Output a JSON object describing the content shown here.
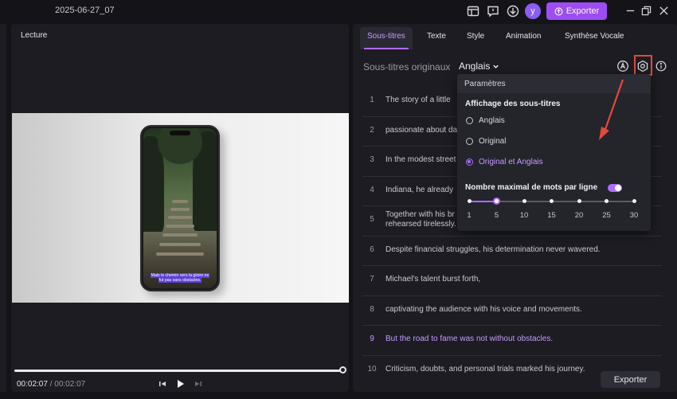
{
  "app": {
    "project_name": "2025-06-27_07",
    "avatar_letter": "y",
    "export_top_label": "Exporter",
    "accent": "#9b4df2",
    "highlight": "#e24a3b"
  },
  "preview": {
    "title": "Lecture",
    "caption_line1": "Mais le chemin vers la gloire ne",
    "caption_line2": "fut pas sans obstacles.",
    "time_current": "00:02:07",
    "time_sep": "/",
    "time_total": "00:02:07",
    "progress": 1.0
  },
  "right": {
    "tabs": [
      {
        "label": "Sous-titres",
        "active": true
      },
      {
        "label": "Texte"
      },
      {
        "label": "Style"
      },
      {
        "label": "Animation"
      },
      {
        "label": "Synthèse Vocale"
      }
    ],
    "orig_label": "Sous-titres originaux",
    "language": "Anglais",
    "rows": [
      {
        "num": "1",
        "text": "The story of a little"
      },
      {
        "num": "2",
        "text": "passionate about da"
      },
      {
        "num": "3",
        "text": "In the modest street"
      },
      {
        "num": "4",
        "text": "Indiana, he already"
      },
      {
        "num": "5",
        "text": "Together with his br",
        "text2": "rehearsed tirelessly."
      },
      {
        "num": "6",
        "text": "Despite financial struggles, his determination never wavered."
      },
      {
        "num": "7",
        "text": "Michael's talent burst forth,"
      },
      {
        "num": "8",
        "text": "captivating the audience with his voice and movements."
      },
      {
        "num": "9",
        "text": "But the road to fame was not without obstacles.",
        "active": true
      },
      {
        "num": "10",
        "text": "Criticism, doubts, and personal trials marked his journey."
      }
    ],
    "export_label": "Exporter"
  },
  "popup": {
    "title": "Paramètres",
    "display_heading": "Affichage des sous-titres",
    "options": [
      {
        "label": "Anglais",
        "selected": false
      },
      {
        "label": "Original",
        "selected": false
      },
      {
        "label": "Original et Anglais",
        "selected": true
      }
    ],
    "max_words_label": "Nombre maximal de mots par ligne",
    "max_words_enabled": true,
    "slider_labels": [
      "1",
      "5",
      "10",
      "15",
      "20",
      "25",
      "30"
    ],
    "slider_value": 5
  }
}
